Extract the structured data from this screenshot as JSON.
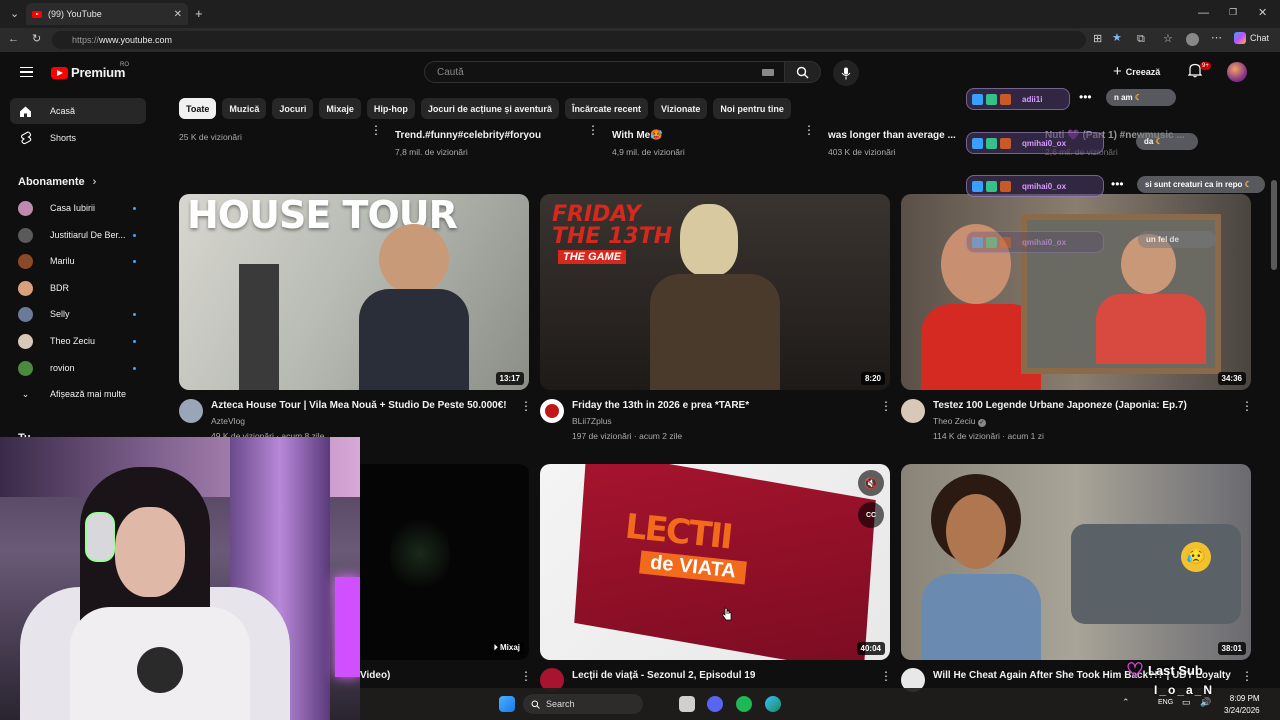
{
  "browser": {
    "tab_title": "(99) YouTube",
    "url_proto": "https://",
    "url_host": "www.youtube.com",
    "chat_label": "Chat"
  },
  "header": {
    "logo_text": "Premium",
    "logo_region": "RO",
    "search_placeholder": "Caută",
    "create_label": "Creează",
    "notif_count": "9+"
  },
  "sidebar": {
    "items": [
      {
        "label": "Acasă",
        "icon": "home-icon"
      },
      {
        "label": "Shorts",
        "icon": "shorts-icon"
      }
    ],
    "subs_header": "Abonamente",
    "subs": [
      {
        "label": "Casa Iubirii",
        "color": "#c08ab0"
      },
      {
        "label": "Justitiarul De Ber...",
        "color": "#5a5a5a"
      },
      {
        "label": "Marilu",
        "color": "#8a4a2a"
      },
      {
        "label": "BDR",
        "color": "#d9a07a"
      },
      {
        "label": "Selly",
        "color": "#6a7a9a"
      },
      {
        "label": "Theo Zeciu",
        "color": "#d8c8b8"
      },
      {
        "label": "rovion",
        "color": "#4a8a3a"
      }
    ],
    "show_more": "Afișează mai multe",
    "partial_heading": "Tu"
  },
  "chips": [
    "Toate",
    "Muzică",
    "Jocuri",
    "Mixaje",
    "Hip-hop",
    "Jocuri de acțiune și aventură",
    "Încărcate recent",
    "Vizionate",
    "Noi pentru tine"
  ],
  "prev_row": [
    {
      "title": "",
      "meta": "25 K de vizionări"
    },
    {
      "title": "Trend.#funny#celebrity#foryou",
      "meta": "7,8 mil. de vizionări"
    },
    {
      "title": "With Me🥵",
      "meta": "4,9 mil. de vizionări"
    },
    {
      "title": "was longer than average ...",
      "meta": "403 K de vizionări"
    },
    {
      "title": "Nuti 💜 (Part 1) #newmusic ...",
      "meta": "2,6 mil. de vizionări"
    }
  ],
  "videos": [
    {
      "title": "Azteca House Tour | Vila Mea Nouă + Studio De Peste 50.000€!",
      "channel": "AzteVlog",
      "meta": "49 K de vizionări · acum 8 zile",
      "duration": "13:17",
      "thumb_text": "HOUSE TOUR"
    },
    {
      "title": "Friday the 13th in 2026 e prea *TARE*",
      "channel": "BLii7Zplus",
      "meta": "197 de vizionări · acum 2 zile",
      "duration": "8:20",
      "thumb_text_1": "FRIDAY",
      "thumb_text_2": "THE 13TH",
      "thumb_text_3": "THE GAME"
    },
    {
      "title": "Testez 100 Legende Urbane Japoneze (Japonia: Ep.7)",
      "channel": "Theo Zeciu",
      "meta": "114 K de vizionări · acum 1 zi",
      "duration": "34:36"
    },
    {
      "title": "Video)",
      "duration_label": "Mixaj"
    },
    {
      "title": "Lecții de viață - Sezonul 2, Episodul 19",
      "duration": "40:04",
      "thumb_text_1": "LECTII",
      "thumb_text_2": "de VIATA"
    },
    {
      "title": "Will He Cheat Again After She Took Him Back?!? | UDY Loyalty",
      "duration": "38:01"
    }
  ],
  "chat": {
    "rows": [
      {
        "name": "adii1i",
        "msg": "n am"
      },
      {
        "name": "qmihai0_ox",
        "msg": "da"
      },
      {
        "name": "qmihai0_ox",
        "msg": "si sunt creaturi ca in repo"
      },
      {
        "name": "qmihai0_ox",
        "msg": "un fel de"
      }
    ]
  },
  "taskbar": {
    "search_label": "Search",
    "lang": "ENG",
    "time": "8:09 PM",
    "date": "3/24/2026"
  },
  "overlay": {
    "last_sub_label": "Last Sub",
    "last_sub_name": "I_o_a_N"
  },
  "colors": {
    "accent_red": "#ff0000",
    "chip_selected": "#f1f1f1",
    "link_blue": "#3ea6ff"
  }
}
